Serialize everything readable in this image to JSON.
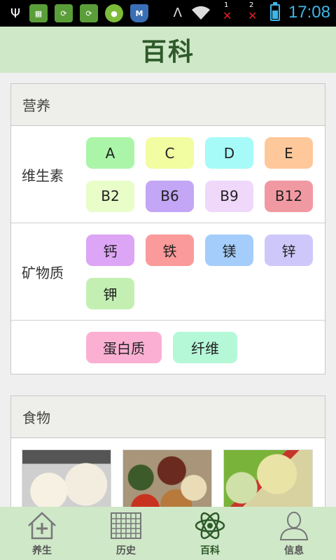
{
  "status_bar": {
    "time": "17:08",
    "sim1": "1",
    "sim2": "2",
    "shield_letter": "M"
  },
  "header": {
    "title": "百科"
  },
  "nutrition": {
    "title": "营养",
    "rows": [
      {
        "label": "维生素",
        "items": [
          {
            "label": "A",
            "color": "#aaf5a8"
          },
          {
            "label": "C",
            "color": "#f2fca0"
          },
          {
            "label": "D",
            "color": "#a6fbf8"
          },
          {
            "label": "E",
            "color": "#fec89a"
          },
          {
            "label": "B2",
            "color": "#e8fdc8"
          },
          {
            "label": "B6",
            "color": "#c3a6f5"
          },
          {
            "label": "B9",
            "color": "#efd8fa"
          },
          {
            "label": "B12",
            "color": "#f199a2"
          }
        ]
      },
      {
        "label": "矿物质",
        "items": [
          {
            "label": "钙",
            "color": "#dda5f5"
          },
          {
            "label": "铁",
            "color": "#fb9a9a"
          },
          {
            "label": "镁",
            "color": "#a4cdfb"
          },
          {
            "label": "锌",
            "color": "#cec8fa"
          },
          {
            "label": "钾",
            "color": "#c3f0b2"
          }
        ]
      },
      {
        "label": "",
        "items": [
          {
            "label": "蛋白质",
            "color": "#fbb0d3"
          },
          {
            "label": "纤维",
            "color": "#b5f8d8"
          }
        ]
      }
    ]
  },
  "food": {
    "title": "食物"
  },
  "tabs": [
    {
      "label": "养生",
      "icon": "house-plus-icon",
      "active": false
    },
    {
      "label": "历史",
      "icon": "calendar-grid-icon",
      "active": false
    },
    {
      "label": "百科",
      "icon": "atom-icon",
      "active": true
    },
    {
      "label": "信息",
      "icon": "person-icon",
      "active": false
    }
  ]
}
